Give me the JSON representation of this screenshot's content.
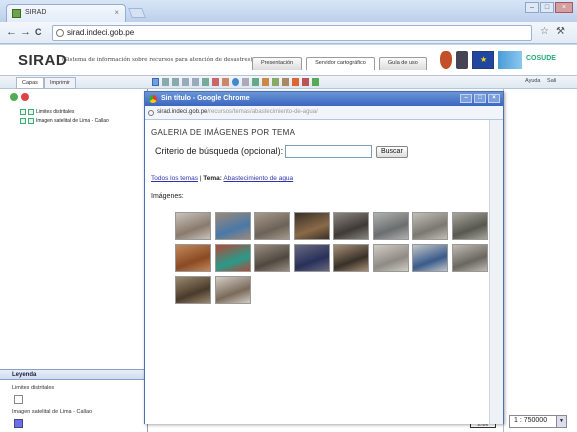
{
  "browser": {
    "tab_title": "SIRAD",
    "tab_close": "×",
    "address": "sirad.indeci.gob.pe",
    "back": "←",
    "forward": "→",
    "reload": "C",
    "star": "☆",
    "wrench": "🔧",
    "window_controls": [
      "–",
      "□",
      "×"
    ]
  },
  "header": {
    "brand": "SIRAD",
    "subtitle": "(Sistema de información sobre recursos para atención de desastres)",
    "tabs": [
      "Presentación",
      "Servidor cartográfico",
      "Guía de uso"
    ],
    "active_tab": 1,
    "cosude": "COSUDE"
  },
  "subbar": {
    "tabs": [
      "Capas",
      "Imprimir"
    ],
    "help": "Ayuda",
    "help_extra": "Sali"
  },
  "layers": {
    "items": [
      "Limites distritales",
      "Imagen satelital de Lima - Callao"
    ]
  },
  "legend": {
    "title": "Leyenda",
    "items": [
      {
        "label": "Limites distritales",
        "color": "#ffffff"
      },
      {
        "label": "Imagen satelital de Lima - Callao",
        "color": "#6e6ee8"
      }
    ]
  },
  "map": {
    "scale_value": "1 : 750000",
    "scale_bar_label": "10 km",
    "scale_arrow": "▼"
  },
  "popup": {
    "title": "Sin título - Google Chrome",
    "url_host": "sirad.indeci.gob.pe",
    "url_path": "/recursos/temas/abastecimiento-de-agua/",
    "gallery_title": "GALERIA DE IMÁGENES POR TEMA",
    "criteria_label": "Criterio de búsqueda (opcional):",
    "search_placeholder": "",
    "search_button": "Buscar",
    "all_topics": "Todos los temas",
    "separator": "|",
    "topic_label": "Tema:",
    "topic_value": "Abastecimiento de agua",
    "images_label": "Imágenes:",
    "thumbnails": [
      {
        "row": 0,
        "col": 0,
        "colors": [
          "#8a7a6c",
          "#c9c4bd"
        ]
      },
      {
        "row": 0,
        "col": 1,
        "colors": [
          "#4a78a8",
          "#9a8a7a"
        ]
      },
      {
        "row": 0,
        "col": 2,
        "colors": [
          "#6c6258",
          "#a89a8a"
        ]
      },
      {
        "row": 0,
        "col": 3,
        "colors": [
          "#8a6a48",
          "#3a3028"
        ]
      },
      {
        "row": 0,
        "col": 4,
        "colors": [
          "#403a36",
          "#8a8680"
        ]
      },
      {
        "row": 0,
        "col": 5,
        "colors": [
          "#6a6e6e",
          "#b0b2b0"
        ]
      },
      {
        "row": 0,
        "col": 6,
        "colors": [
          "#7a7870",
          "#c2c0b8"
        ]
      },
      {
        "row": 0,
        "col": 7,
        "colors": [
          "#585850",
          "#a8a69c"
        ]
      },
      {
        "row": 1,
        "col": 0,
        "colors": [
          "#8a4a24",
          "#c28a5a"
        ]
      },
      {
        "row": 1,
        "col": 1,
        "colors": [
          "#2a9a8a",
          "#b04a3a"
        ]
      },
      {
        "row": 1,
        "col": 2,
        "colors": [
          "#504840",
          "#9a8e80"
        ]
      },
      {
        "row": 1,
        "col": 3,
        "colors": [
          "#28305a",
          "#6a6a80"
        ]
      },
      {
        "row": 1,
        "col": 4,
        "colors": [
          "#383028",
          "#a89078"
        ]
      },
      {
        "row": 1,
        "col": 5,
        "colors": [
          "#908a84",
          "#d0ccc6"
        ]
      },
      {
        "row": 1,
        "col": 6,
        "colors": [
          "#3a5a8a",
          "#c2c6ca"
        ]
      },
      {
        "row": 1,
        "col": 7,
        "colors": [
          "#6a6660",
          "#c0bcb4"
        ]
      },
      {
        "row": 2,
        "col": 0,
        "colors": [
          "#4a3a2a",
          "#9a8a70"
        ]
      },
      {
        "row": 2,
        "col": 1,
        "colors": [
          "#7a6a5a",
          "#d2cdc6"
        ]
      }
    ]
  }
}
